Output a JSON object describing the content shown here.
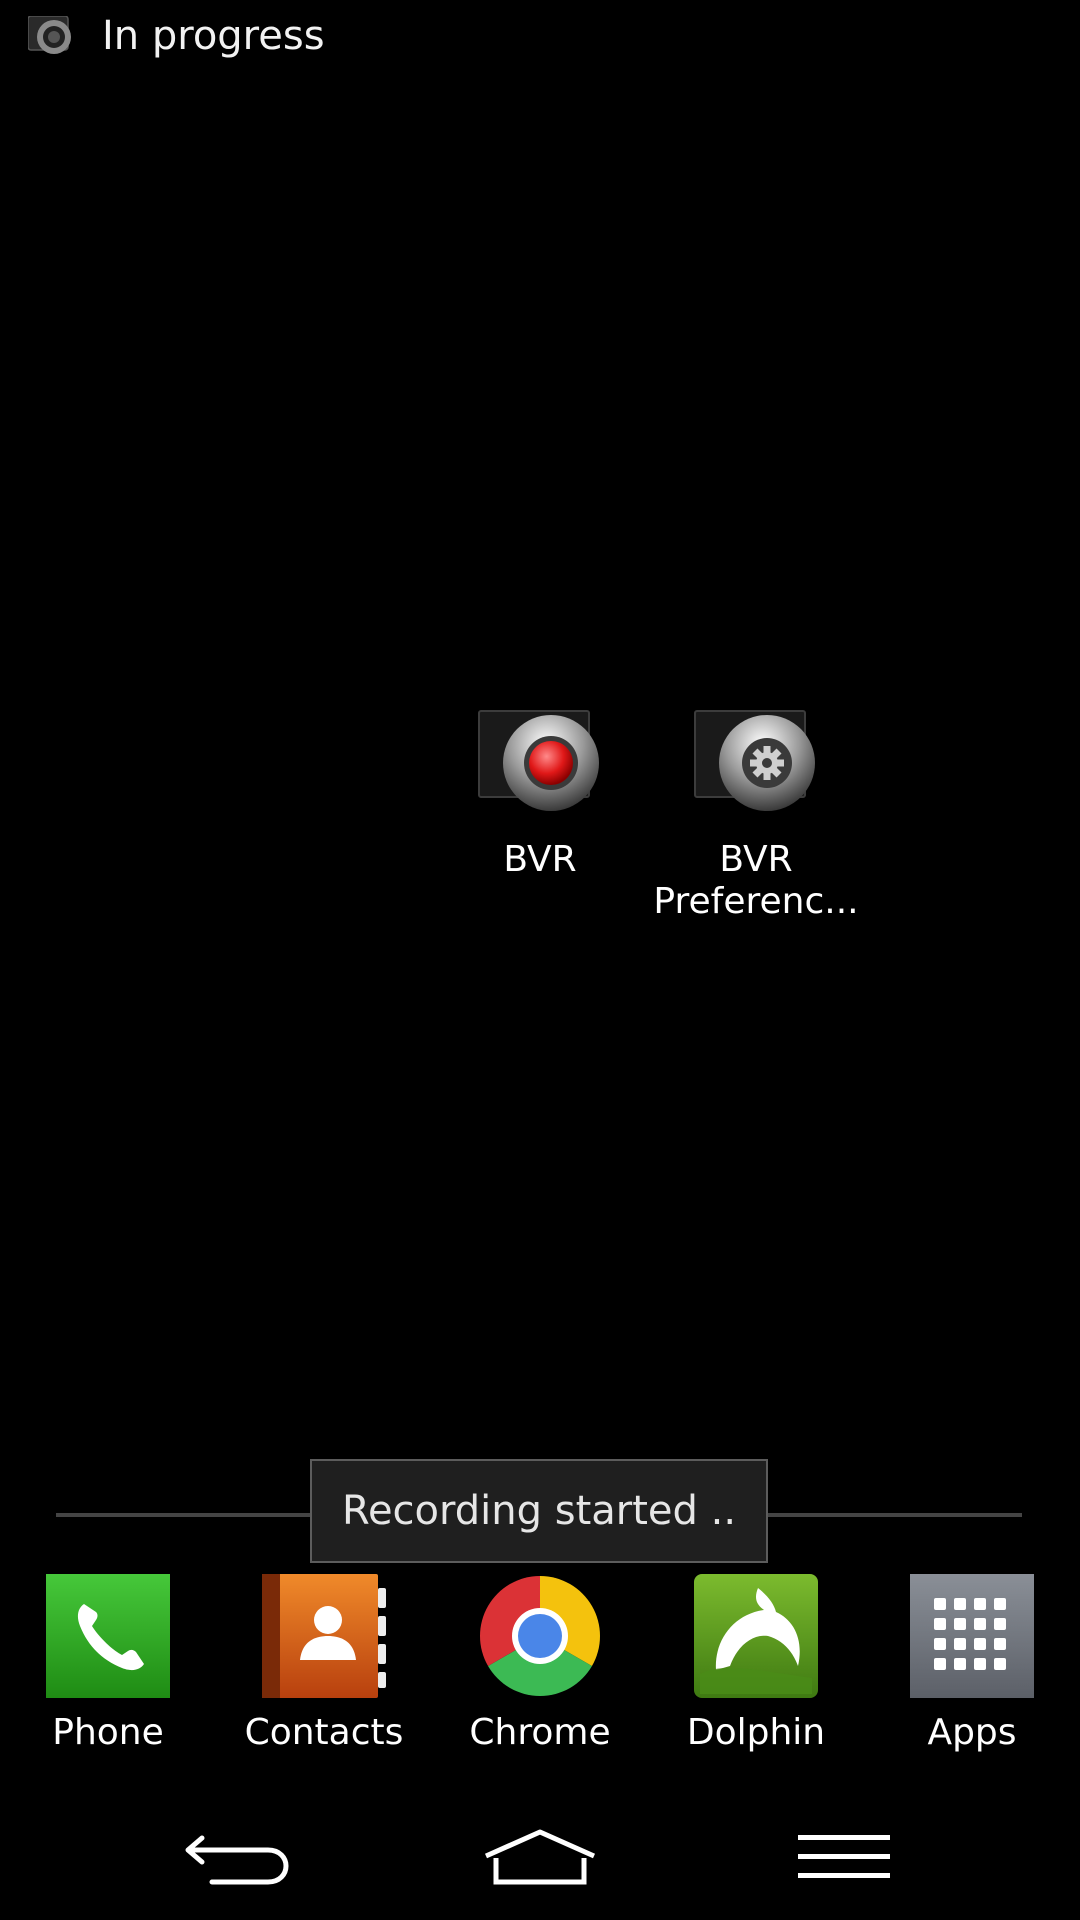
{
  "status_bar": {
    "notification_icon": "camera-lens-icon",
    "text": "In progress"
  },
  "home_shortcuts": [
    {
      "label": "BVR",
      "icon": "record-button-icon"
    },
    {
      "label": "BVR Preferenc...",
      "label_line1": "BVR",
      "label_line2": "Preferenc...",
      "icon": "settings-gear-icon"
    }
  ],
  "toast": {
    "text": "Recording started .."
  },
  "dock": [
    {
      "label": "Phone",
      "icon": "phone-icon",
      "color": "#2fa81e"
    },
    {
      "label": "Contacts",
      "icon": "contacts-book-icon",
      "color": "#d8621a"
    },
    {
      "label": "Chrome",
      "icon": "chrome-icon",
      "color": "#4a86e8"
    },
    {
      "label": "Dolphin",
      "icon": "dolphin-icon",
      "color": "#5e9a1e"
    },
    {
      "label": "Apps",
      "icon": "apps-grid-icon",
      "color": "#6f747c"
    }
  ],
  "nav_bar": {
    "back": "back-icon",
    "home": "home-icon",
    "menu": "menu-icon"
  }
}
